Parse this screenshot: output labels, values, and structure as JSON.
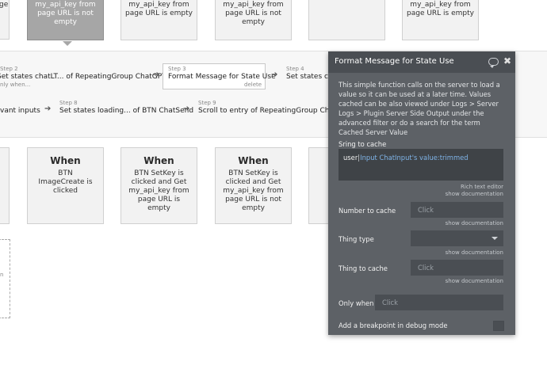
{
  "top_cards": [
    {
      "text": "ge"
    },
    {
      "text": "my_api_key from page URL is not empty"
    },
    {
      "text": "my_api_key from page URL is empty"
    },
    {
      "text": "my_api_key from page URL is not empty"
    },
    {
      "text": ""
    },
    {
      "text": "my_api_key from page URL is empty"
    }
  ],
  "steps": {
    "step2": {
      "num": "Step 2",
      "name": "Set states chatLT... of RepeatingGroup ChatGPT",
      "sub": "nly when..."
    },
    "step3": {
      "num": "Step 3",
      "name": "Format Message for State Use",
      "delete": "delete"
    },
    "step4": {
      "num": "Step 4",
      "name": "Set states cha"
    },
    "step7": {
      "name": "vant inputs"
    },
    "step8": {
      "num": "Step 8",
      "name": "Set states loading... of BTN ChatSend"
    },
    "step9": {
      "num": "Step 9",
      "name": "Scroll to entry of RepeatingGroup ChatGPT"
    }
  },
  "bottom_cards": [
    {
      "when": "When",
      "cond": "BTN ImageCreate is clicked"
    },
    {
      "when": "When",
      "cond": "BTN SetKey is clicked and Get my_api_key from page URL is empty"
    },
    {
      "when": "When",
      "cond": "BTN SetKey is clicked and Get my_api_key from page URL is not empty"
    },
    {
      "when": "",
      "cond": ""
    }
  ],
  "left_partial": {
    "text": "n"
  },
  "panel": {
    "title": "Format Message for State Use",
    "description": "This simple function calls on the server to load a value so it can be used at a later time. Values cached can be also viewed under Logs > Server Logs > Plugin Server Side Output under the advanced filter or do a search for the term Cached Server Value",
    "string_label": "Sring to cache",
    "string_value_prefix": "user",
    "string_value_caret": "|",
    "string_value_expr": "Input ChatInput's value:trimmed",
    "rich_text_editor": "Rich text editor",
    "show_doc": "show documentation",
    "number_label": "Number to cache",
    "number_placeholder": "Click",
    "thing_type_label": "Thing type",
    "thing_type_value": "",
    "thing_label": "Thing to cache",
    "thing_placeholder": "Click",
    "only_when_label": "Only when",
    "only_when_placeholder": "Click",
    "breakpoint_label": "Add a breakpoint in debug mode",
    "colors": {
      "panel_bg": "#5d6166",
      "header_bg": "#4a4e53",
      "expr": "#7fb4e8"
    }
  }
}
